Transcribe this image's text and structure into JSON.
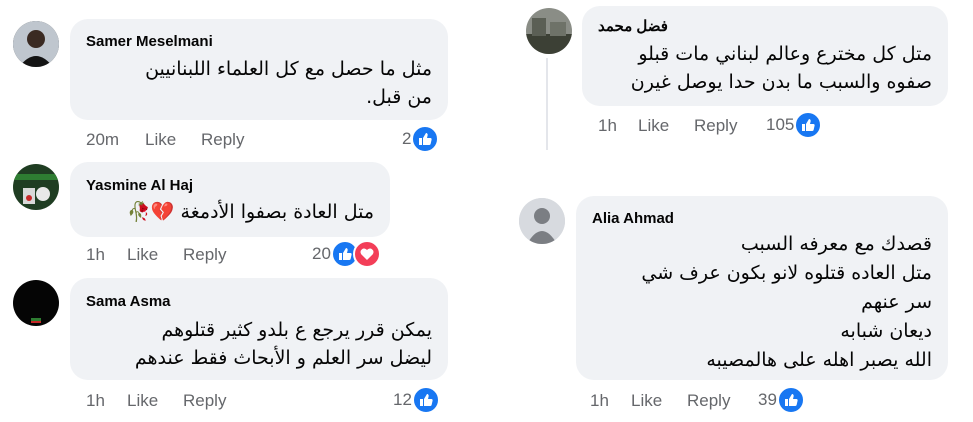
{
  "comments_left": [
    {
      "name": "Samer Meselmani",
      "lines": [
        "مثل ما حصل مع كل العلماء اللبنانيين",
        "من قبل."
      ],
      "time": "20m",
      "like": "Like",
      "reply": "Reply",
      "reactions": "2"
    },
    {
      "name": "Yasmine Al Haj",
      "lines": [
        "متل العادة بصفوا الأدمغة 💔🥀"
      ],
      "time": "1h",
      "like": "Like",
      "reply": "Reply",
      "reactions": "20"
    },
    {
      "name": "Sama Asma",
      "lines": [
        "يمكن قرر يرجع ع بلدو كثير قتلوهم",
        "ليضل سر العلم و الأبحاث فقط عندهم"
      ],
      "time": "1h",
      "like": "Like",
      "reply": "Reply",
      "reactions": "12"
    }
  ],
  "comments_right": [
    {
      "name": "فضل محمد",
      "lines": [
        "متل كل مخترع وعالم لبناني مات قبلو",
        "صفوه والسبب ما بدن حدا يوصل غيرن"
      ],
      "time": "1h",
      "like": "Like",
      "reply": "Reply",
      "reactions": "105"
    },
    {
      "name": "Alia Ahmad",
      "lines": [
        "قصدك مع معرفه السبب",
        "متل العاده قتلوه لانو بكون عرف شي",
        "سر عنهم",
        "ديعان شبابه",
        "الله يصبر اهله على هالمصيبه"
      ],
      "time": "1h",
      "like": "Like",
      "reply": "Reply",
      "reactions": "39"
    }
  ],
  "colors": {
    "bubble": "#f0f2f5",
    "like_blue": "#1877f2",
    "love_red": "#f33e58",
    "meta_gray": "#65676b"
  },
  "icons": {
    "like": "like-reaction-icon",
    "love": "love-reaction-icon",
    "default_avatar": "default-avatar-icon"
  }
}
